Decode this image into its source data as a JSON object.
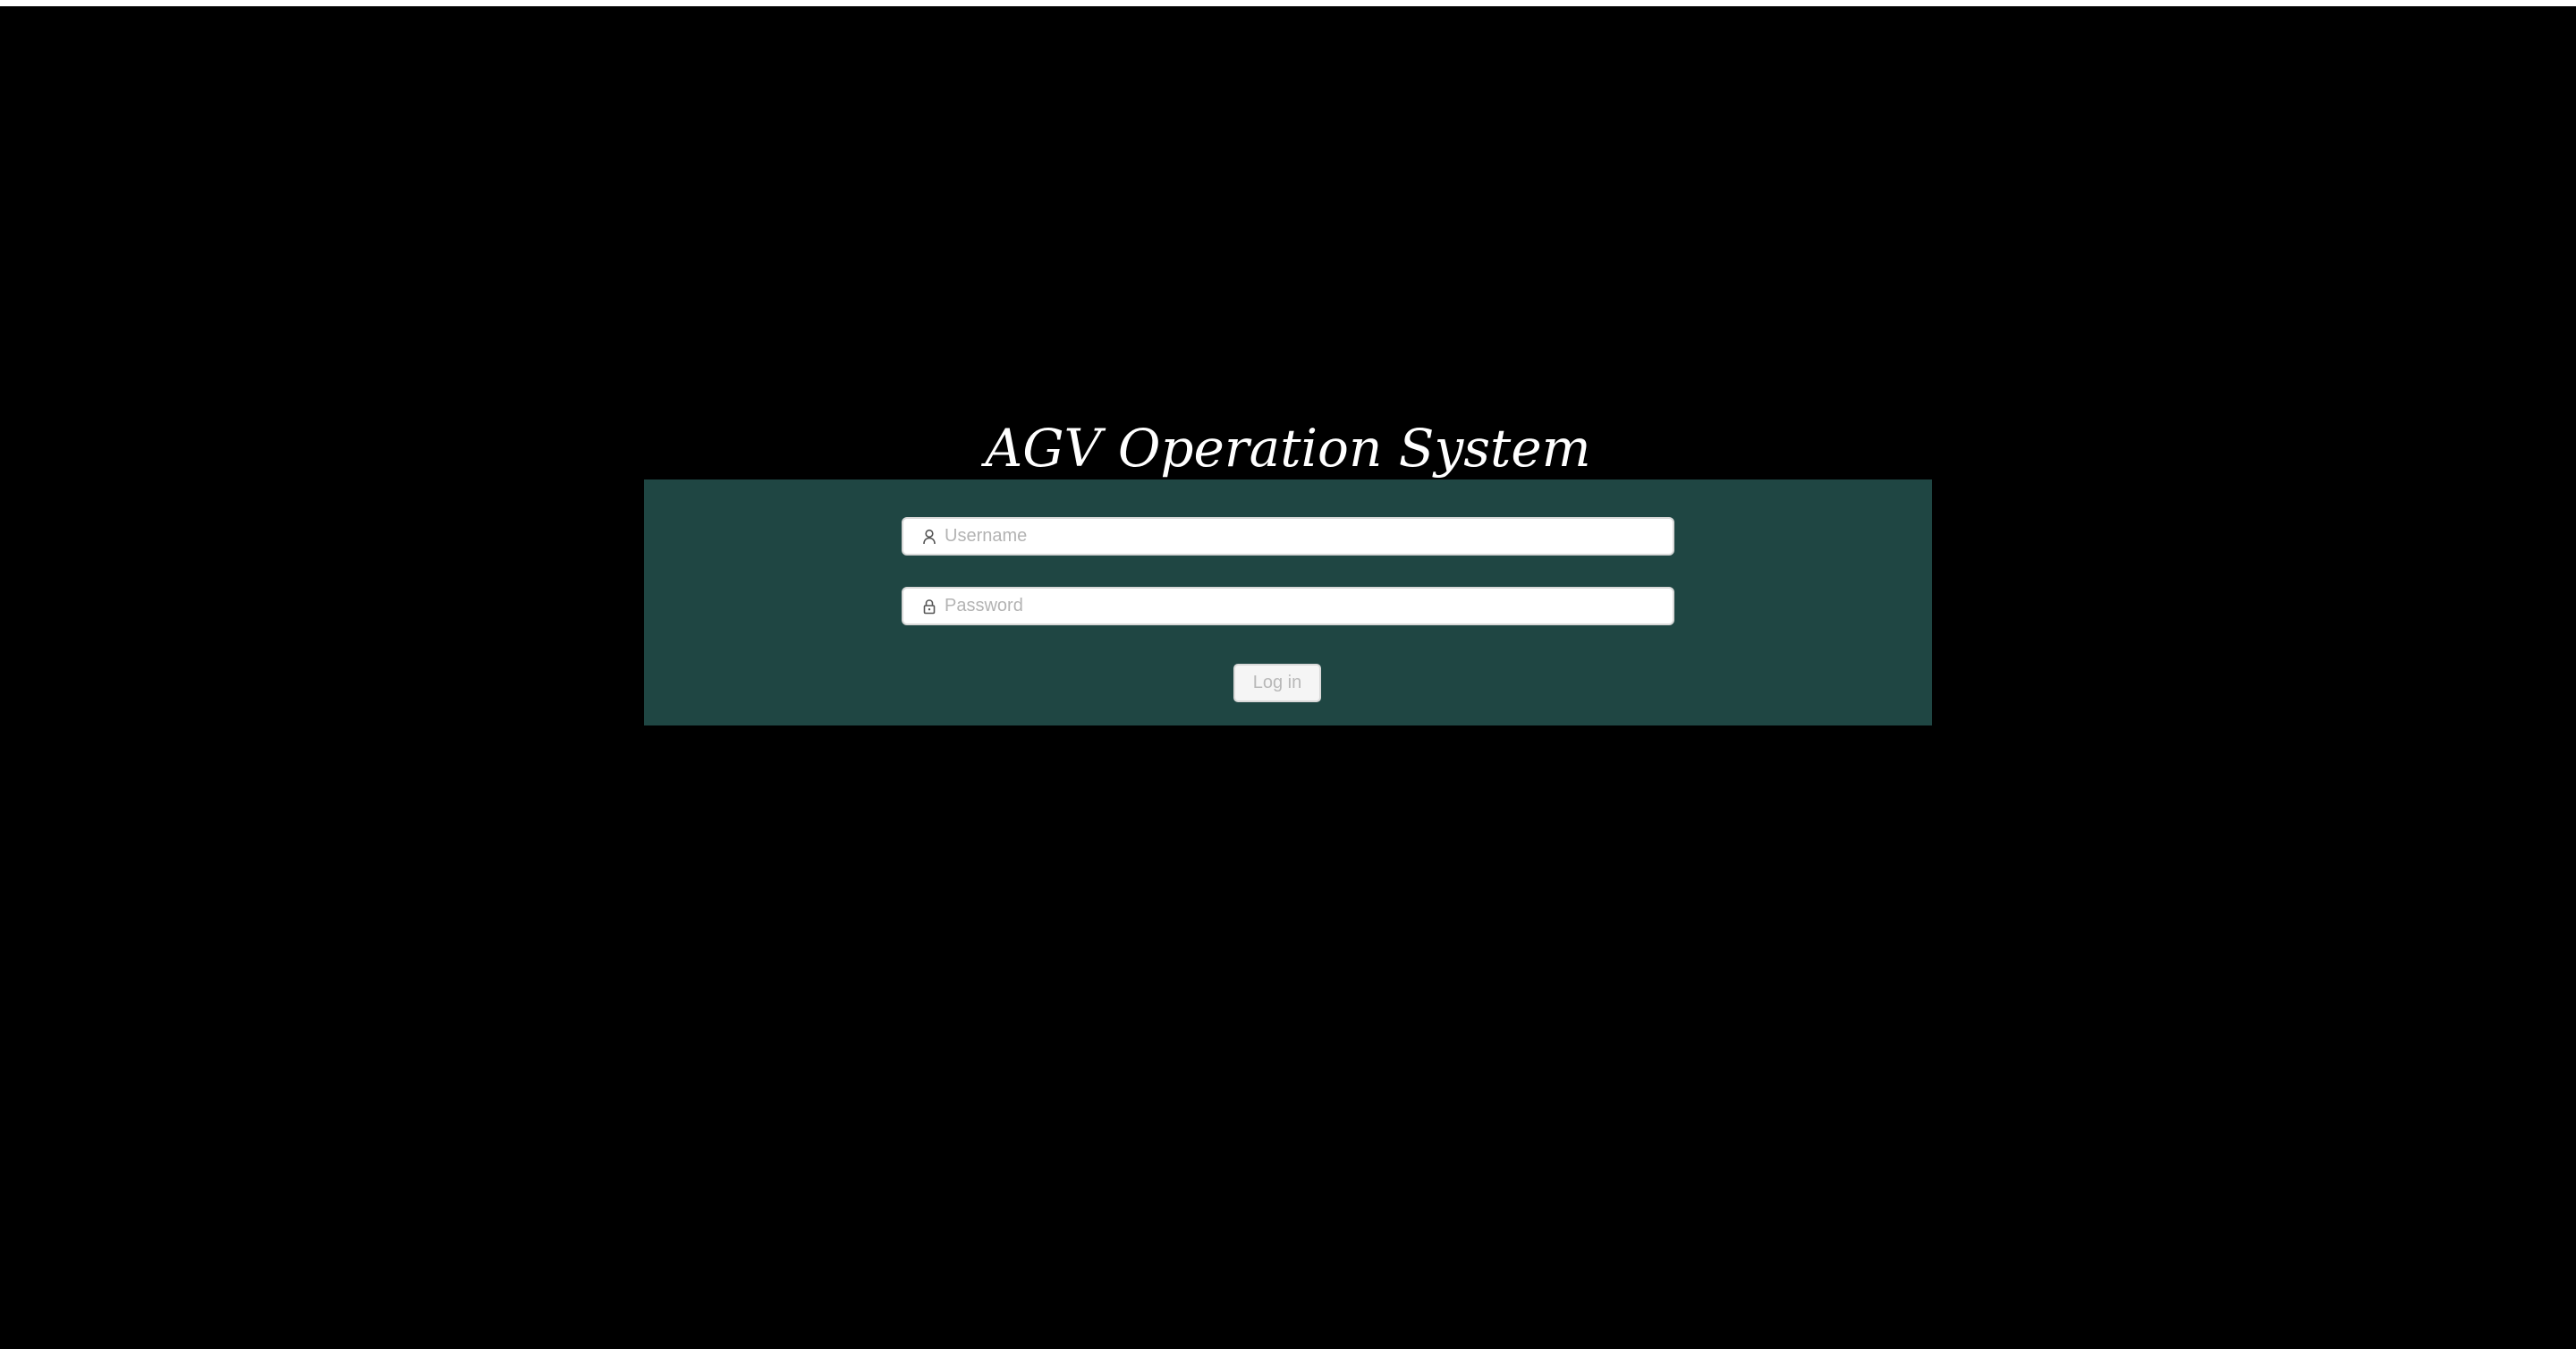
{
  "app": {
    "title": "AGV Operation System"
  },
  "login_form": {
    "username": {
      "placeholder": "Username",
      "value": "",
      "icon": "user-icon"
    },
    "password": {
      "placeholder": "Password",
      "value": "",
      "icon": "lock-icon"
    },
    "submit_label": "Log in",
    "submit_disabled": true
  },
  "colors": {
    "page_background": "#000000",
    "panel_background": "#1f4643",
    "title_text": "#ffffff",
    "input_background": "#ffffff",
    "placeholder_text": "#b3b3b3",
    "button_background": "#f5f5f5",
    "button_text": "#b8b8b8"
  }
}
